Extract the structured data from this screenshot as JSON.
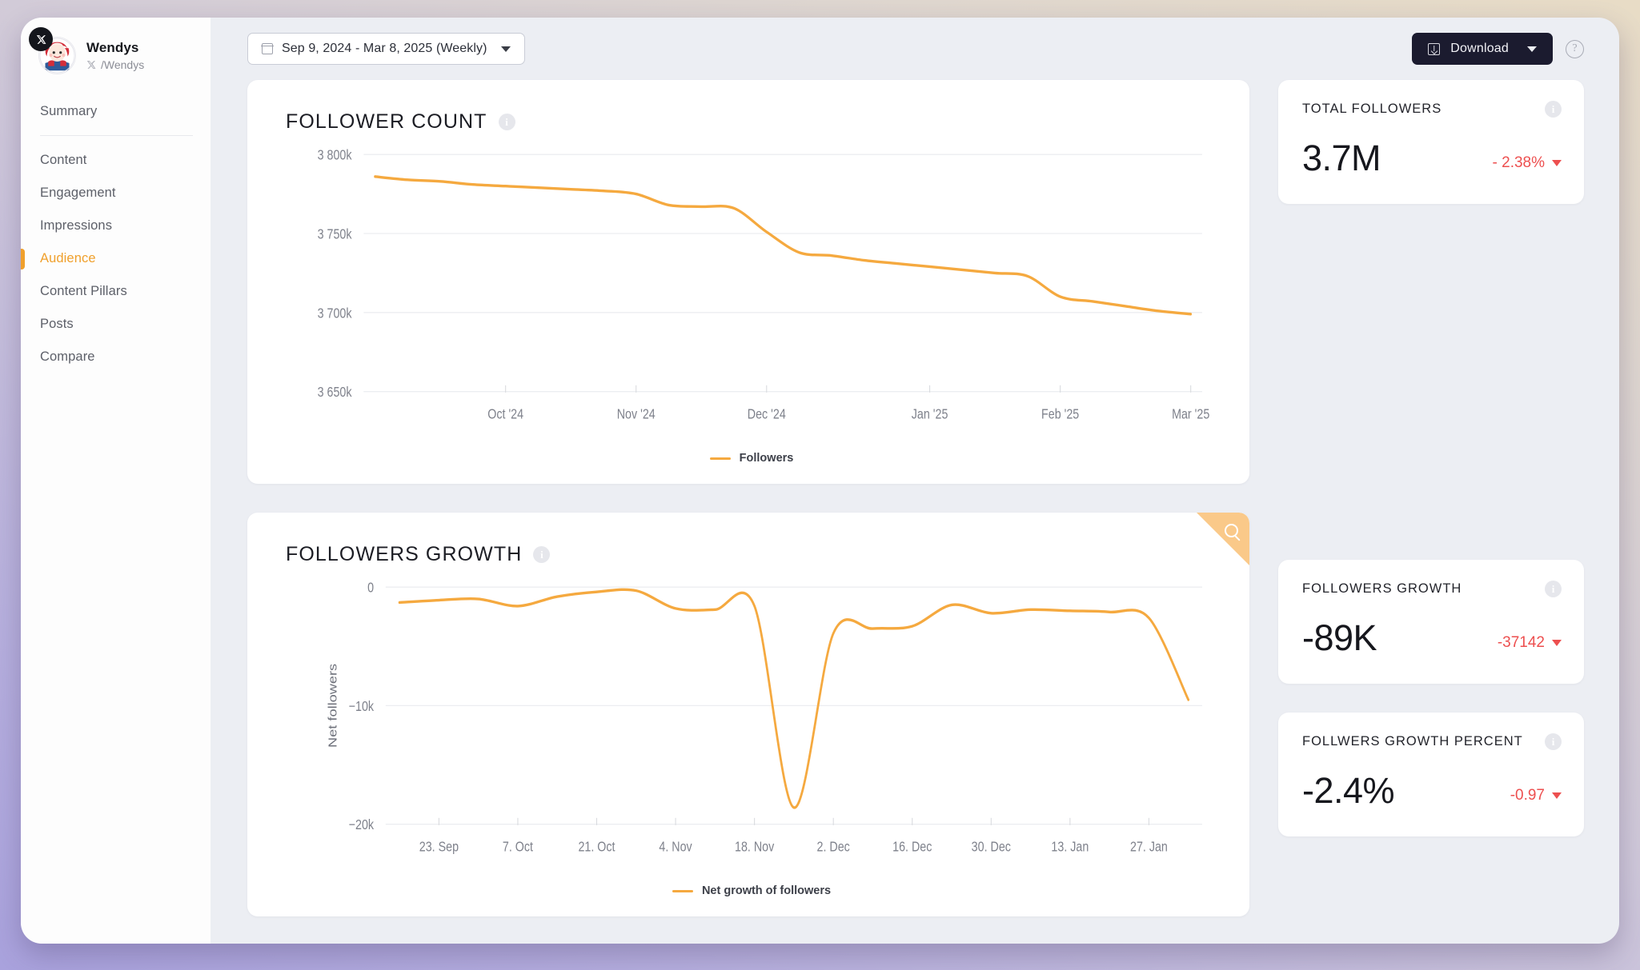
{
  "profile": {
    "name": "Wendys",
    "handle": "/Wendys",
    "platform_badge": "x-icon",
    "avatar_alt": "wendys-avatar"
  },
  "sidebar": {
    "items": [
      {
        "label": "Summary",
        "active": false
      },
      {
        "label": "Content",
        "active": false
      },
      {
        "label": "Engagement",
        "active": false
      },
      {
        "label": "Impressions",
        "active": false
      },
      {
        "label": "Audience",
        "active": true
      },
      {
        "label": "Content Pillars",
        "active": false
      },
      {
        "label": "Posts",
        "active": false
      },
      {
        "label": "Compare",
        "active": false
      }
    ]
  },
  "topbar": {
    "date_range": "Sep 9, 2024 - Mar 8, 2025 (Weekly)",
    "download_label": "Download",
    "help_label": "?"
  },
  "cards": {
    "follower_count": {
      "title": "FOLLOWER COUNT",
      "info": "i"
    },
    "followers_growth": {
      "title": "FOLLOWERS GROWTH",
      "info": "i"
    }
  },
  "kpis": [
    {
      "id": "total-followers",
      "title": "TOTAL FOLLOWERS",
      "value": "3.7M",
      "delta": "- 2.38%",
      "delta_direction": "down",
      "delta_color": "#ed4f4f",
      "info": "i"
    },
    {
      "id": "followers-growth",
      "title": "FOLLOWERS GROWTH",
      "value": "-89K",
      "delta": "-37142",
      "delta_direction": "down",
      "delta_color": "#ed4f4f",
      "info": "i"
    },
    {
      "id": "followers-growth-percent",
      "title": "FOLLWERS GROWTH PERCENT",
      "value": "-2.4%",
      "delta": "-0.97",
      "delta_direction": "down",
      "delta_color": "#ed4f4f",
      "info": "i"
    }
  ],
  "theme": {
    "accent": "#f0a02c",
    "series": "#f5a93f",
    "negative": "#ed4f4f",
    "dark": "#1b1b2f"
  },
  "chart_data": [
    {
      "id": "follower-count",
      "type": "line",
      "title": "FOLLOWER COUNT",
      "xlabel": "",
      "ylabel": "",
      "ylim": [
        3650000,
        3800000
      ],
      "yticks": [
        3650000,
        3700000,
        3750000,
        3800000
      ],
      "ytick_labels": [
        "3 650k",
        "3 700k",
        "3 750k",
        "3 800k"
      ],
      "xtick_labels": [
        "Oct '24",
        "Nov '24",
        "Dec '24",
        "Jan '25",
        "Feb '25",
        "Mar '25"
      ],
      "grid": true,
      "legend": [
        {
          "name": "Followers",
          "color": "#f5a93f"
        }
      ],
      "series": [
        {
          "name": "Followers",
          "color": "#f5a93f",
          "x": [
            "2024-09-09",
            "2024-09-16",
            "2024-09-23",
            "2024-09-30",
            "2024-10-07",
            "2024-10-14",
            "2024-10-21",
            "2024-10-28",
            "2024-11-04",
            "2024-11-11",
            "2024-11-18",
            "2024-11-25",
            "2024-12-02",
            "2024-12-09",
            "2024-12-16",
            "2024-12-23",
            "2024-12-30",
            "2025-01-06",
            "2025-01-13",
            "2025-01-20",
            "2025-01-27",
            "2025-02-03",
            "2025-02-10",
            "2025-02-17",
            "2025-02-24",
            "2025-03-03"
          ],
          "values": [
            3786000,
            3784000,
            3783000,
            3781000,
            3780000,
            3779000,
            3778000,
            3777000,
            3775000,
            3768000,
            3767000,
            3766000,
            3751000,
            3738000,
            3736000,
            3733000,
            3731000,
            3729000,
            3727000,
            3725000,
            3723000,
            3710000,
            3707000,
            3704000,
            3701000,
            3699000
          ]
        }
      ]
    },
    {
      "id": "followers-growth",
      "type": "line",
      "title": "FOLLOWERS GROWTH",
      "xlabel": "",
      "ylabel": "Net followers",
      "ylim": [
        -20000,
        0
      ],
      "yticks": [
        -20000,
        -10000,
        0
      ],
      "ytick_labels": [
        "−20k",
        "−10k",
        "0"
      ],
      "xtick_labels": [
        "23. Sep",
        "7. Oct",
        "21. Oct",
        "4. Nov",
        "18. Nov",
        "2. Dec",
        "16. Dec",
        "30. Dec",
        "13. Jan",
        "27. Jan"
      ],
      "grid": true,
      "legend": [
        {
          "name": "Net growth of followers",
          "color": "#f5a93f"
        }
      ],
      "series": [
        {
          "name": "Net growth of followers",
          "color": "#f5a93f",
          "x": [
            "2024-09-16",
            "2024-09-23",
            "2024-09-30",
            "2024-10-07",
            "2024-10-14",
            "2024-10-21",
            "2024-10-28",
            "2024-11-04",
            "2024-11-11",
            "2024-11-18",
            "2024-11-25",
            "2024-12-02",
            "2024-12-09",
            "2024-12-16",
            "2024-12-23",
            "2024-12-30",
            "2025-01-06",
            "2025-01-13",
            "2025-01-20",
            "2025-01-27",
            "2025-02-03"
          ],
          "values": [
            -1300,
            -1100,
            -1000,
            -1600,
            -800,
            -400,
            -300,
            -1800,
            -1900,
            -1600,
            -18600,
            -3900,
            -3500,
            -3300,
            -1500,
            -2200,
            -1900,
            -2000,
            -2100,
            -2600,
            -9500
          ]
        }
      ]
    }
  ]
}
